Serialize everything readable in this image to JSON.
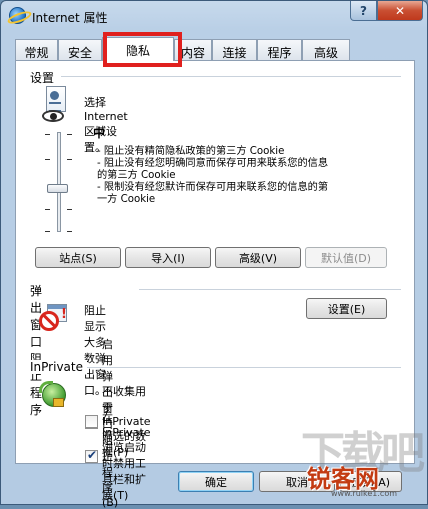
{
  "window": {
    "title": "Internet 属性",
    "help": "?",
    "close": "✕"
  },
  "tabs": [
    "常规",
    "安全",
    "隐私",
    "内容",
    "连接",
    "程序",
    "高级"
  ],
  "settings": {
    "group_label": "设置",
    "zone_prompt": "选择 Internet 区域设置。",
    "level": "中",
    "description": [
      "- 阻止没有精简隐私政策的第三方 Cookie",
      "- 阻止没有经您明确同意而保存可用来联系您的信息",
      "的第三方 Cookie",
      "- 限制没有经您默许而保存可用来联系您的信息的第",
      "一方 Cookie"
    ],
    "buttons": {
      "sites": "站点(S)",
      "import": "导入(I)",
      "advanced": "高级(V)",
      "default": "默认值(D)"
    }
  },
  "popup": {
    "group_label": "弹出窗口阻止程序",
    "text": "阻止显示大多数弹出窗口。",
    "settings_button": "设置(E)",
    "enable_label": "启用弹出窗口阻止程序(B)",
    "enable_checked": true
  },
  "inprivate": {
    "group_label": "InPrivate",
    "no_collect_label": "不收集用于 InPrivate 筛选的数据(P)",
    "no_collect_checked": false,
    "disable_toolbars_label": "在 InPrivate 浏览启动时禁用工具栏和扩展(T)",
    "disable_toolbars_checked": true
  },
  "footer": {
    "ok": "确定",
    "cancel": "取消",
    "apply": "应用(A)"
  },
  "watermark": {
    "big": "下载吧",
    "brand": "锐客网",
    "url": "www.ruike1.com"
  },
  "colors": {
    "highlight": "#e0201e",
    "watermark": "#c33b12"
  }
}
